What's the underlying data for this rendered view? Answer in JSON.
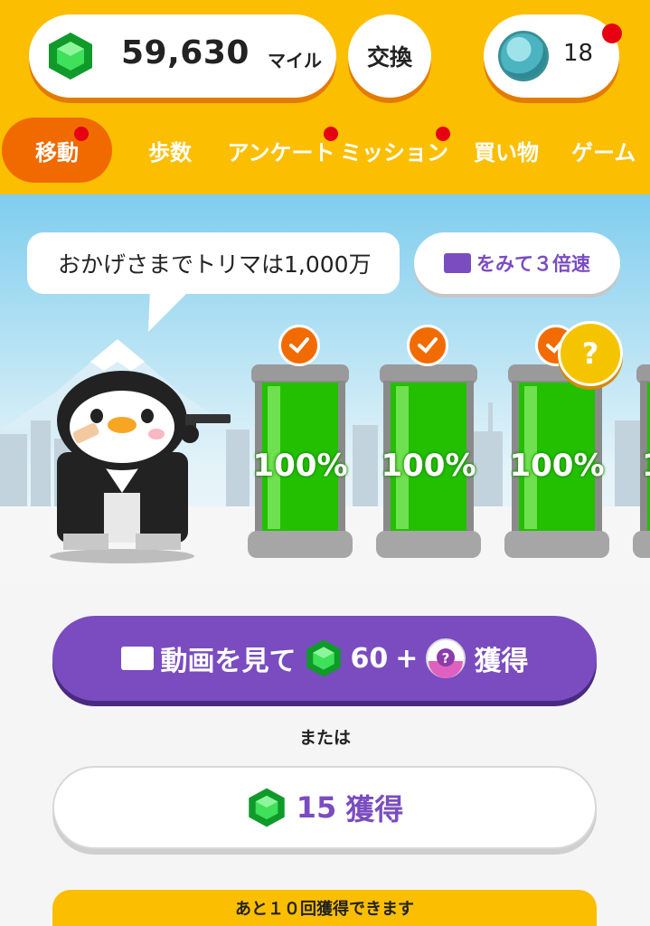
{
  "header": {
    "miles_value": "59,630",
    "miles_unit": "マイル",
    "exchange_label": "交換",
    "coin_count": "18"
  },
  "tabs": [
    {
      "label": "移動",
      "active": true,
      "has_dot": true
    },
    {
      "label": "歩数",
      "active": false,
      "has_dot": false
    },
    {
      "label": "アンケート",
      "active": false,
      "has_dot": true
    },
    {
      "label": "ミッション",
      "active": false,
      "has_dot": true
    },
    {
      "label": "買い物",
      "active": false,
      "has_dot": false
    },
    {
      "label": "ゲーム",
      "active": false,
      "has_dot": false
    }
  ],
  "scene": {
    "speech": "おかげさまでトリマは1,000万",
    "video_button_label": "をみて３倍速",
    "tanks": [
      {
        "percent": "100%",
        "fill": 1.0
      },
      {
        "percent": "100%",
        "fill": 1.0
      },
      {
        "percent": "100%",
        "fill": 1.0
      },
      {
        "percent": "1",
        "fill": 1.0
      }
    ],
    "mystery_badge": "?"
  },
  "actions": {
    "watch_prefix": "動画を見て",
    "watch_amount": "60",
    "watch_plus": "+",
    "watch_suffix": "獲得",
    "or_text": "または",
    "earn_amount": "15",
    "earn_suffix": "獲得",
    "remaining_text": "あと１０回獲得できます"
  },
  "colors": {
    "header_bg": "#fbbe00",
    "active_tab": "#f06a00",
    "purple": "#7a4cc0",
    "notify": "#e60012",
    "tank_green": "#22c000"
  },
  "icons": [
    "emerald-gem-icon",
    "fish-coin-icon",
    "film-icon",
    "check-icon",
    "question-icon",
    "mystery-orb-icon"
  ]
}
